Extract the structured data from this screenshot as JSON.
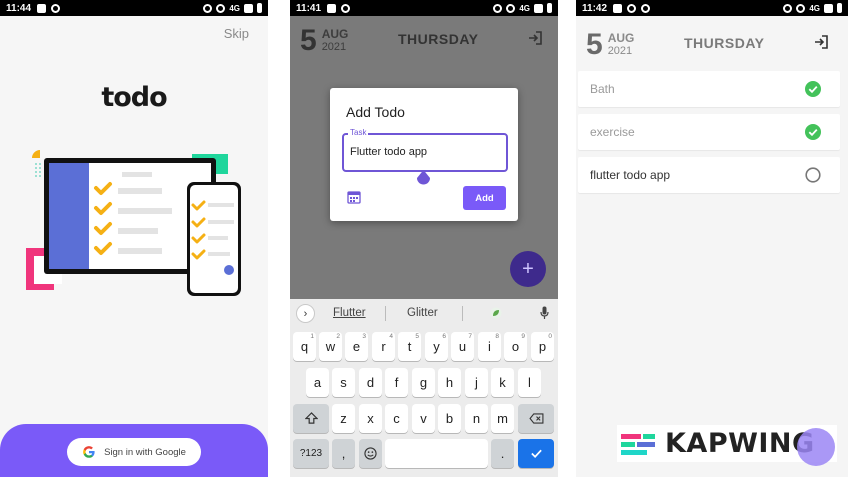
{
  "phone1": {
    "status": {
      "time": "11:44"
    },
    "skip_label": "Skip",
    "logo_text": "todo",
    "google_button_label": "Sign in with Google",
    "colors": {
      "brand": "#7a5af8",
      "accent_yellow": "#f5b014",
      "accent_blue": "#5b6fd6",
      "accent_pink": "#f0357c",
      "accent_green": "#1fd69c"
    }
  },
  "phone2": {
    "status": {
      "time": "11:41"
    },
    "header": {
      "day": "5",
      "month": "AUG",
      "year": "2021",
      "weekday": "THURSDAY"
    },
    "dialog": {
      "title": "Add Todo",
      "field_label": "Task",
      "field_value": "Flutter todo app",
      "add_label": "Add"
    },
    "fab_icon": "plus-icon",
    "keyboard": {
      "suggestions": [
        "Flutter",
        "Glitter"
      ],
      "row1": [
        [
          "q",
          "1"
        ],
        [
          "w",
          "2"
        ],
        [
          "e",
          "3"
        ],
        [
          "r",
          "4"
        ],
        [
          "t",
          "5"
        ],
        [
          "y",
          "6"
        ],
        [
          "u",
          "7"
        ],
        [
          "i",
          "8"
        ],
        [
          "o",
          "9"
        ],
        [
          "p",
          "0"
        ]
      ],
      "row2": [
        "a",
        "s",
        "d",
        "f",
        "g",
        "h",
        "j",
        "k",
        "l"
      ],
      "row3": [
        "z",
        "x",
        "c",
        "v",
        "b",
        "n",
        "m"
      ],
      "bottom": {
        "symbols": "?123",
        "comma": ",",
        "period": "."
      }
    }
  },
  "phone3": {
    "status": {
      "time": "11:42"
    },
    "header": {
      "day": "5",
      "month": "AUG",
      "year": "2021",
      "weekday": "THURSDAY"
    },
    "todos": [
      {
        "text": "Bath",
        "done": true
      },
      {
        "text": "exercise",
        "done": true
      },
      {
        "text": "flutter todo app",
        "done": false
      }
    ],
    "colors": {
      "done_green": "#43c25a",
      "done_text": "#9a9a9a",
      "pending_text": "#333333"
    }
  },
  "watermark": {
    "text": "KAPWING"
  },
  "status_network": "4G"
}
